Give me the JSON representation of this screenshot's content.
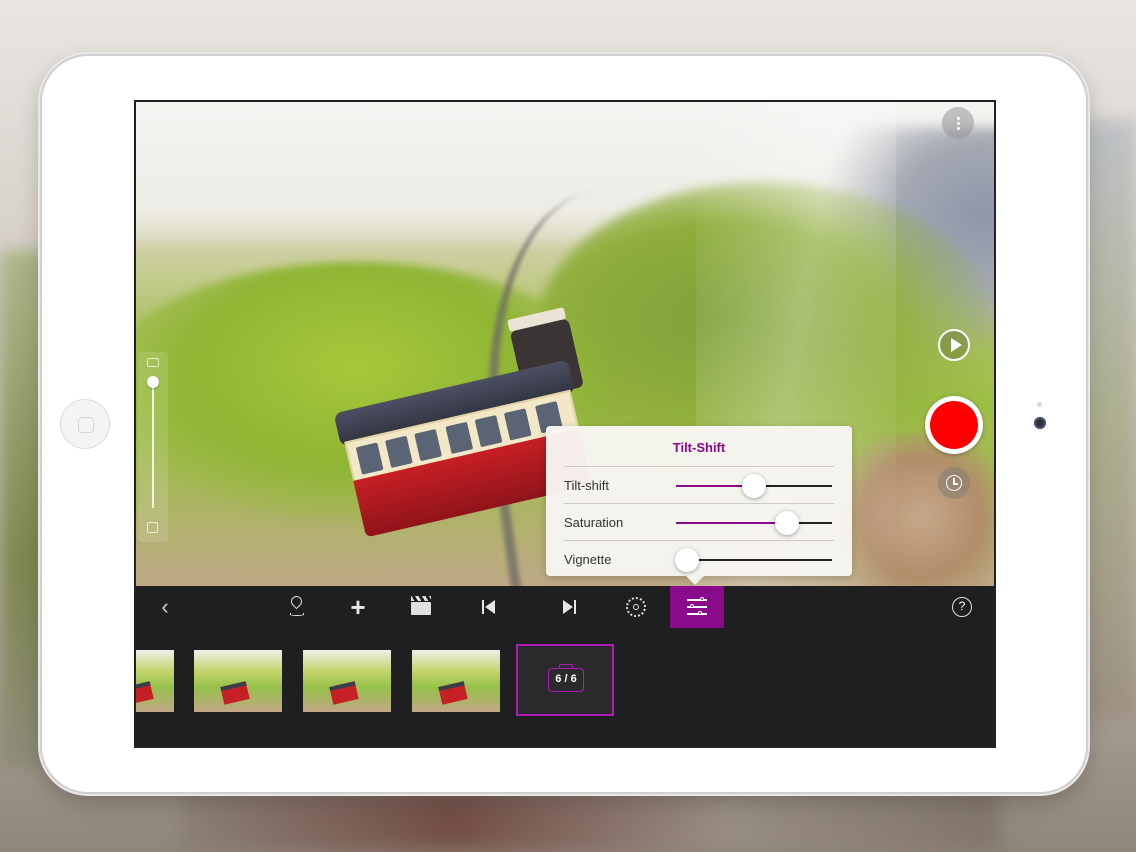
{
  "popover": {
    "title": "Tilt-Shift",
    "sliders": [
      {
        "label": "Tilt-shift",
        "value": 0.5
      },
      {
        "label": "Saturation",
        "value": 0.71
      },
      {
        "label": "Vignette",
        "value": 0.07
      }
    ]
  },
  "zoom": {
    "value": 1.0
  },
  "toolbar": {
    "back_icon": "chevron-left-icon",
    "location_icon": "map-pin-icon",
    "add_icon": "plus-icon",
    "clapper_icon": "clapperboard-icon",
    "prev_icon": "skip-back-icon",
    "next_icon": "skip-forward-icon",
    "settings_icon": "gear-icon",
    "adjust_icon": "sliders-icon",
    "help_label": "?"
  },
  "filmstrip": {
    "count_label": "6 / 6",
    "thumbnails": 4
  },
  "colors": {
    "accent": "#8a0a8c",
    "record": "#ff0000",
    "toolbar_bg": "#1f1f21"
  }
}
